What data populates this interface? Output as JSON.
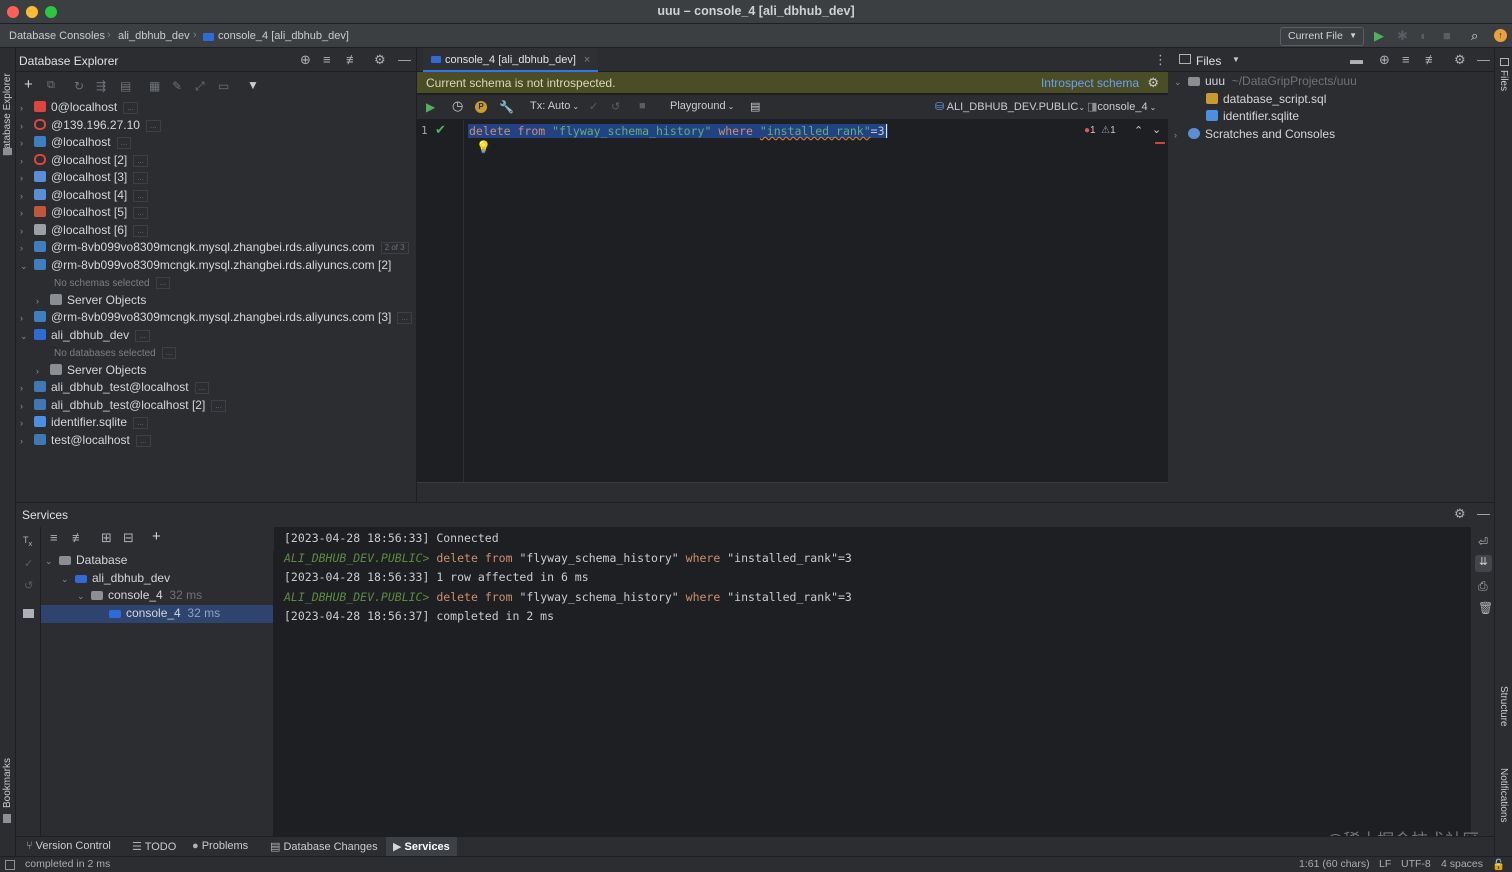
{
  "window": {
    "title": "uuu – console_4 [ali_dbhub_dev]"
  },
  "navbar": {
    "crumbs": [
      "Database Consoles",
      "ali_dbhub_dev",
      "console_4 [ali_dbhub_dev]"
    ],
    "run_config": "Current File"
  },
  "left_strip": {
    "db_explorer": "Database Explorer",
    "bookmarks": "Bookmarks"
  },
  "db_explorer": {
    "title": "Database Explorer",
    "items": [
      {
        "label": "0@localhost",
        "badge": "...",
        "icon": "redis-icon",
        "color": "#e0443e",
        "open": false,
        "depth": 0
      },
      {
        "label": "@139.196.27.10",
        "badge": "...",
        "icon": "oracle-icon",
        "color": "#e0443e",
        "open": false,
        "depth": 0
      },
      {
        "label": "@localhost",
        "badge": "...",
        "icon": "mysql-icon",
        "color": "#3d7fbf",
        "open": false,
        "depth": 0
      },
      {
        "label": "@localhost [2]",
        "badge": "...",
        "icon": "oracle-icon",
        "color": "#e0443e",
        "open": false,
        "depth": 0
      },
      {
        "label": "@localhost [3]",
        "badge": "...",
        "icon": "triangle-db-icon",
        "color": "#5a8fd8",
        "open": false,
        "depth": 0
      },
      {
        "label": "@localhost [4]",
        "badge": "...",
        "icon": "triangle-db-icon",
        "color": "#5a8fd8",
        "open": false,
        "depth": 0
      },
      {
        "label": "@localhost [5]",
        "badge": "...",
        "icon": "redis-icon",
        "color": "#c2563a",
        "open": false,
        "depth": 0
      },
      {
        "label": "@localhost [6]",
        "badge": "...",
        "icon": "chart-db-icon",
        "color": "#9aa0a6",
        "open": false,
        "depth": 0
      },
      {
        "label": "@rm-8vb099vo8309mcngk.mysql.zhangbei.rds.aliyuncs.com",
        "badge": "2 of 3",
        "icon": "mysql-icon",
        "color": "#3d7fbf",
        "open": false,
        "depth": 0
      },
      {
        "label": "@rm-8vb099vo8309mcngk.mysql.zhangbei.rds.aliyuncs.com [2]",
        "badge": "",
        "icon": "mysql-icon",
        "color": "#3d7fbf",
        "open": true,
        "depth": 0
      },
      {
        "label": "No schemas selected",
        "badge": "...",
        "icon": "",
        "color": "",
        "open": null,
        "depth": 1,
        "dim": true
      },
      {
        "label": "Server Objects",
        "badge": "",
        "icon": "folder-icon",
        "color": "#8b8e93",
        "open": false,
        "depth": 1
      },
      {
        "label": "@rm-8vb099vo8309mcngk.mysql.zhangbei.rds.aliyuncs.com [3]",
        "badge": "...",
        "icon": "mysql-icon",
        "color": "#3d7fbf",
        "open": false,
        "depth": 0
      },
      {
        "label": "ali_dbhub_dev",
        "badge": "...",
        "icon": "h2-icon",
        "color": "#2f6bd6",
        "open": true,
        "depth": 0
      },
      {
        "label": "No databases selected",
        "badge": "...",
        "icon": "",
        "color": "",
        "open": null,
        "depth": 1,
        "dim": true
      },
      {
        "label": "Server Objects",
        "badge": "",
        "icon": "folder-icon",
        "color": "#8b8e93",
        "open": false,
        "depth": 1
      },
      {
        "label": "ali_dbhub_test@localhost",
        "badge": "...",
        "icon": "postgres-icon",
        "color": "#3f78b5",
        "open": false,
        "depth": 0
      },
      {
        "label": "ali_dbhub_test@localhost [2]",
        "badge": "...",
        "icon": "postgres-icon",
        "color": "#3f78b5",
        "open": false,
        "depth": 0
      },
      {
        "label": "identifier.sqlite",
        "badge": "...",
        "icon": "sqlite-icon",
        "color": "#4a8fe0",
        "open": false,
        "depth": 0
      },
      {
        "label": "test@localhost",
        "badge": "...",
        "icon": "postgres-icon",
        "color": "#3f78b5",
        "open": false,
        "depth": 0
      }
    ]
  },
  "editor": {
    "tab_label": "console_4 [ali_dbhub_dev]",
    "banner_message": "Current schema is not introspected.",
    "banner_action": "Introspect schema",
    "tx_mode": "Tx: Auto",
    "playground": "Playground",
    "schema": "ALI_DBHUB_DEV.PUBLIC",
    "session": "console_4",
    "line_number": "1",
    "code": {
      "kw1": "delete",
      "kw2": "from",
      "table": "\"flyway_schema_history\"",
      "kw3": "where",
      "column": "\"installed_rank\"",
      "rest": "=3"
    },
    "errors": "1",
    "warnings": "1"
  },
  "files": {
    "title": "Files",
    "root": "uuu",
    "root_path": "~/DataGripProjects/uuu",
    "children": [
      "database_script.sql",
      "identifier.sqlite"
    ],
    "scratches": "Scratches and Consoles"
  },
  "right_strip": {
    "files": "Files",
    "structure": "Structure",
    "notifications": "Notifications"
  },
  "services": {
    "title": "Services",
    "tree": [
      {
        "label": "Database",
        "meta": "",
        "depth": 0
      },
      {
        "label": "ali_dbhub_dev",
        "meta": "",
        "depth": 1
      },
      {
        "label": "console_4",
        "meta": "32 ms",
        "depth": 2
      },
      {
        "label": "console_4",
        "meta": "32 ms",
        "depth": 3,
        "selected": true
      }
    ],
    "output": [
      {
        "kind": "log",
        "text": "[2023-04-28 18:56:33] Connected"
      },
      {
        "kind": "sql",
        "prompt": "ALI_DBHUB_DEV.PUBLIC>",
        "k1": "delete",
        "k2": "from",
        "t": "\"flyway_schema_history\"",
        "k3": "where",
        "c": "\"installed_rank\"",
        "v": "=3"
      },
      {
        "kind": "log",
        "text": "[2023-04-28 18:56:33] 1 row affected in 6 ms"
      },
      {
        "kind": "sql",
        "prompt": "ALI_DBHUB_DEV.PUBLIC>",
        "k1": "delete",
        "k2": "from",
        "t": "\"flyway_schema_history\"",
        "k3": "where",
        "c": "\"installed_rank\"",
        "v": "=3"
      },
      {
        "kind": "log",
        "text": "[2023-04-28 18:56:37] completed in 2 ms"
      }
    ]
  },
  "bottom_tabs": [
    "Version Control",
    "TODO",
    "Problems",
    "Database Changes",
    "Services"
  ],
  "status": {
    "message": "completed in 2 ms",
    "position": "1:61 (60 chars)",
    "line_sep": "LF",
    "encoding": "UTF-8",
    "indent": "4 spaces"
  },
  "watermark": "@稀土掘金技术社区",
  "colors": {
    "accent": "#3574f0",
    "banner": "#4b4d24",
    "keyword": "#cf8e6d",
    "string": "#6aab73",
    "prompt": "#5e8a3f",
    "selection": "#214283"
  }
}
